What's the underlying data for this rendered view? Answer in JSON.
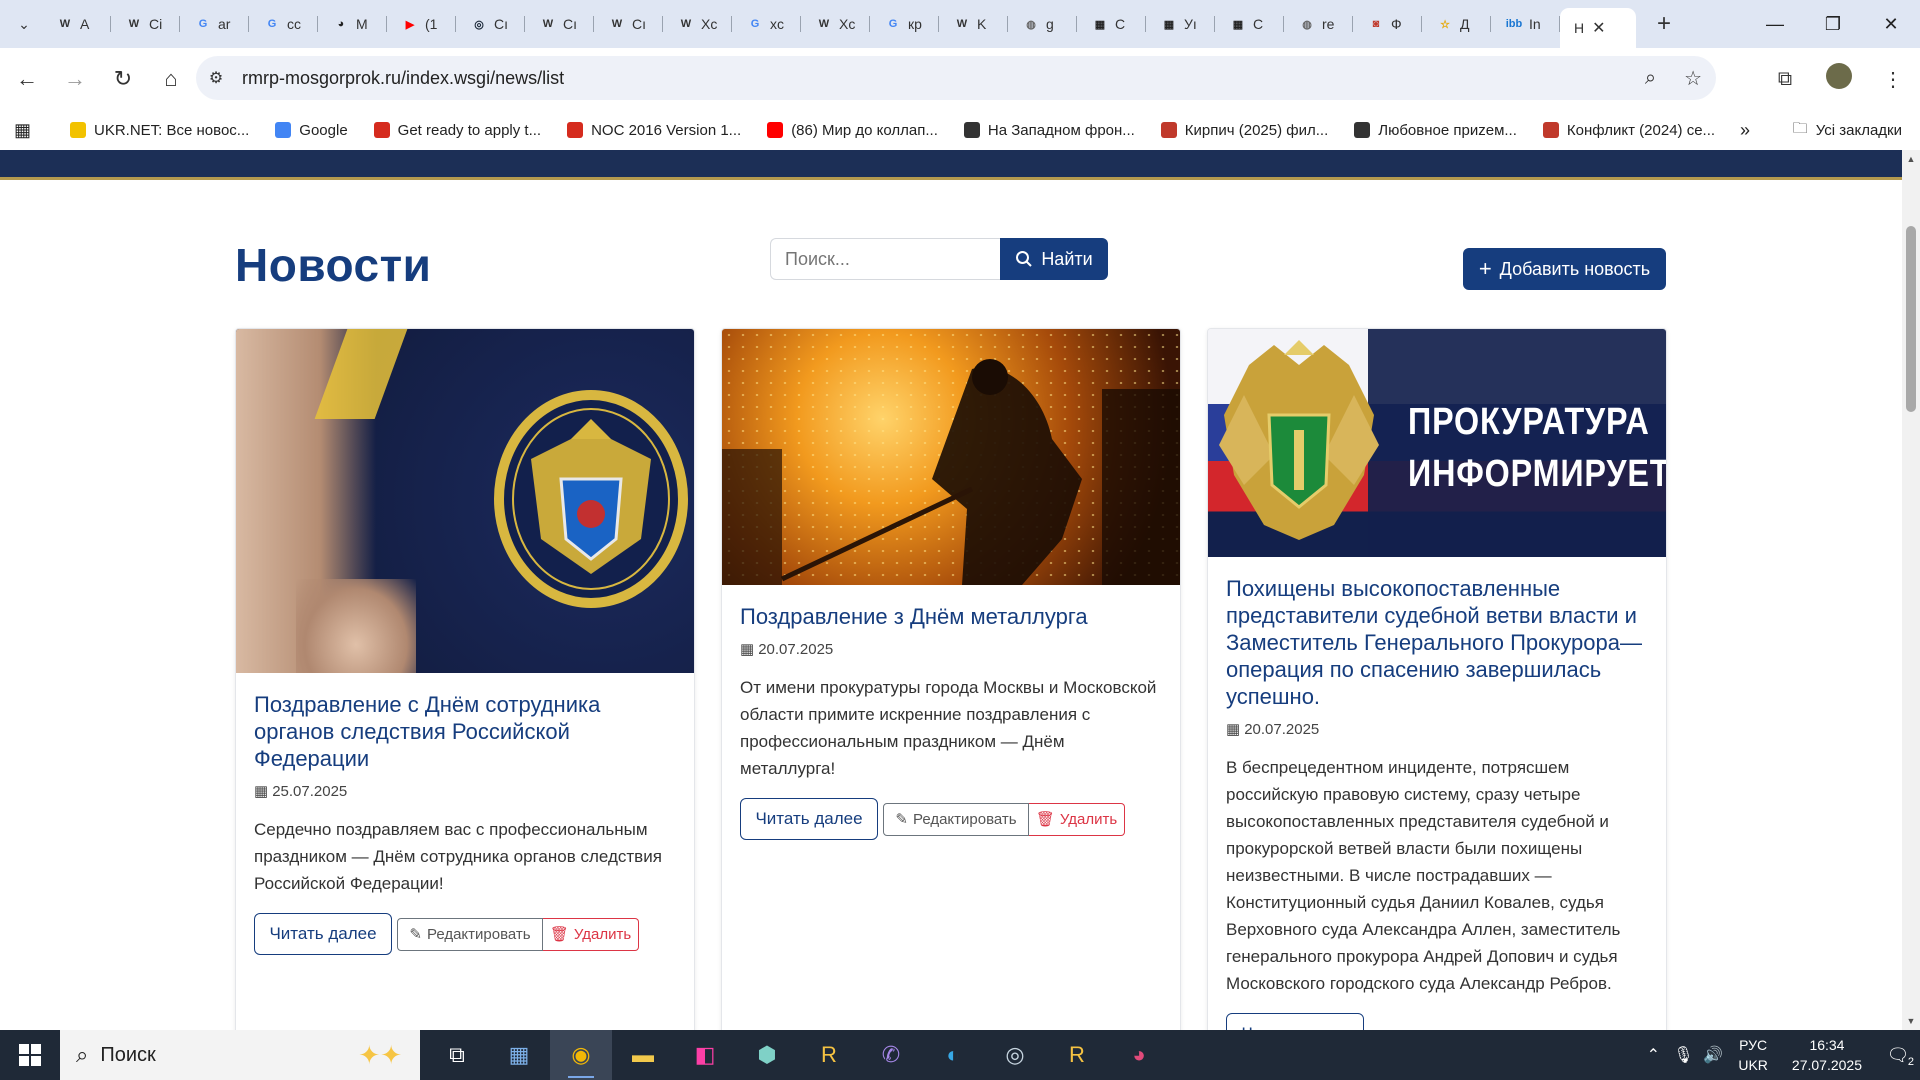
{
  "browser": {
    "tabs": [
      {
        "label": "A",
        "icon": "wiki-icon",
        "fav": "W"
      },
      {
        "label": "Ci",
        "icon": "wiki-icon",
        "fav": "W"
      },
      {
        "label": "ar",
        "icon": "google-icon",
        "fav": "G"
      },
      {
        "label": "cc",
        "icon": "google-icon",
        "fav": "G"
      },
      {
        "label": "M",
        "icon": "spy-icon",
        "fav": "◕"
      },
      {
        "label": "(1",
        "icon": "youtube-icon",
        "fav": "▶"
      },
      {
        "label": "Cı",
        "icon": "steam-icon",
        "fav": "◎"
      },
      {
        "label": "Cı",
        "icon": "wiki-icon",
        "fav": "W"
      },
      {
        "label": "Cı",
        "icon": "wiki-icon",
        "fav": "W"
      },
      {
        "label": "Xc",
        "icon": "wiki-icon",
        "fav": "W"
      },
      {
        "label": "xc",
        "icon": "google-icon",
        "fav": "G"
      },
      {
        "label": "Xc",
        "icon": "wiki-icon",
        "fav": "W"
      },
      {
        "label": "кр",
        "icon": "google-icon",
        "fav": "G"
      },
      {
        "label": "K",
        "icon": "wiki-icon",
        "fav": "W"
      },
      {
        "label": "g",
        "icon": "globe-icon",
        "fav": "◍"
      },
      {
        "label": "C",
        "icon": "clapper-icon",
        "fav": "▦"
      },
      {
        "label": "Уı",
        "icon": "clapper-icon",
        "fav": "▦"
      },
      {
        "label": "C",
        "icon": "clapper-icon",
        "fav": "▦"
      },
      {
        "label": "re",
        "icon": "globe-icon",
        "fav": "◍"
      },
      {
        "label": "Ф",
        "icon": "film-icon",
        "fav": "◙"
      },
      {
        "label": "Д",
        "icon": "star-icon",
        "fav": "☆"
      },
      {
        "label": "In",
        "icon": "ibb-icon",
        "fav": "ibb"
      }
    ],
    "active_tab": {
      "label": "Н"
    },
    "url": "rmrp-mosgorprok.ru/index.wsgi/news/list",
    "bookmarks": [
      {
        "label": "UKR.NET: Все новос...",
        "icon": "ukrnet-icon",
        "color": "#f2c200"
      },
      {
        "label": "Google",
        "icon": "google-icon",
        "color": "#4285f4"
      },
      {
        "label": "Get ready to apply t...",
        "icon": "maple-leaf-icon",
        "color": "#d52b1e"
      },
      {
        "label": "NOC 2016 Version 1...",
        "icon": "maple-leaf-icon",
        "color": "#d52b1e"
      },
      {
        "label": "(86) Мир до коллап...",
        "icon": "youtube-icon",
        "color": "#ff0000"
      },
      {
        "label": "На Западном фрон...",
        "icon": "spy-icon",
        "color": "#333333"
      },
      {
        "label": "Кирпич (2025) фил...",
        "icon": "film-icon",
        "color": "#c0392b"
      },
      {
        "label": "Любовное приzем...",
        "icon": "spy-icon",
        "color": "#333333"
      },
      {
        "label": "Конфликт (2024) се...",
        "icon": "film-icon",
        "color": "#c0392b"
      }
    ],
    "more_label": "»",
    "all_bookmarks_label": "Усі закладки"
  },
  "page": {
    "title": "Новости",
    "search_placeholder": "Поиск...",
    "search_button": "Найти",
    "add_button": "Добавить новость",
    "read_more": "Читать далее",
    "edit": "Редактировать",
    "delete": "Удалить"
  },
  "news": [
    {
      "title": "Поздравление с Днём сотрудника органов следствия Российской Федерации",
      "date": "25.07.2025",
      "text": "Сердечно поздравляем вас с профессиональным праздником — Днём сотрудника органов следствия Российской Федерации!"
    },
    {
      "title": "Поздравление з Днём металлурга",
      "date": "20.07.2025",
      "text": "От имени прокуратуры города Москвы и Московской области примите искренние поздравления с профессиональным праздником — Днём металлурга!"
    },
    {
      "title": "Похищены высокопоставленные представители судебной ветви власти и Заместитель Генерального Прокурора— операция по спасению завершилась успешно.",
      "date": "20.07.2025",
      "text": "В беспрецедентном инциденте, потрясшем российскую правовую систему, сразу четыре высокопоставленных представителя судебной и прокурорской ветвей власти были похищены неизвестными. В числе пострадавших — Конституционный судья Даниил Ковалев, судья Верховного суда Александра Аллен, заместитель генерального прокурора Андрей Допович и судья Московского городского суда Александр Ребров.",
      "banner_text": [
        "ПРОКУРАТУРА",
        "ИНФОРМИРУЕТ"
      ]
    }
  ],
  "taskbar": {
    "search_label": "Поиск",
    "lang_top": "РУС",
    "lang_bottom": "UKR",
    "time": "16:34",
    "date": "27.07.2025",
    "notifications": "2"
  },
  "colors": {
    "brand": "#163d7e",
    "danger": "#dc3545",
    "header_band": "#1c2f56"
  }
}
